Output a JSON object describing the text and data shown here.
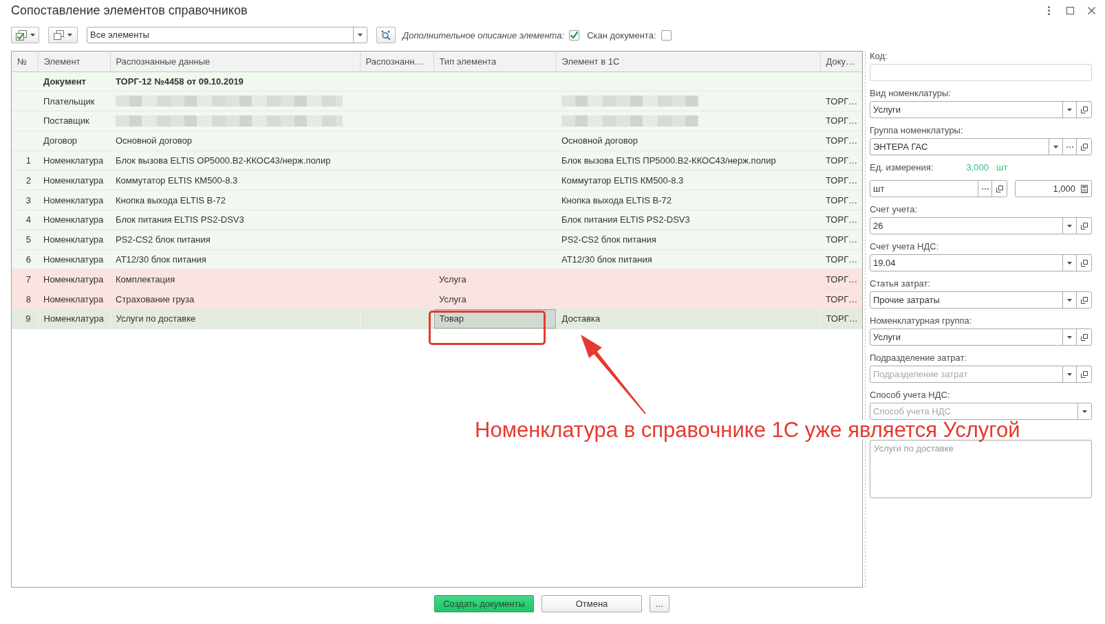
{
  "window": {
    "title": "Сопоставление элементов справочников"
  },
  "toolbar": {
    "filter": {
      "value": "Все элементы"
    },
    "options": [
      {
        "label": "Дополнительное описание элемента:",
        "italic": true,
        "checked": true
      },
      {
        "label": "Скан документа:",
        "italic": false,
        "checked": false
      }
    ]
  },
  "table": {
    "columns": [
      "№",
      "Элемент",
      "Распознанные данные",
      "Распознанн…",
      "Тип элемента",
      "Элемент в 1С",
      "Доку…"
    ],
    "rows": [
      {
        "kind": "document",
        "color": "#f1f8ef",
        "selected": false,
        "redacted": false,
        "type_cell_focused": false,
        "element": "Документ",
        "recognized_data": "ТОРГ-12 №4458 от 09.10.2019"
      },
      {
        "kind": "item",
        "color": "#f1f8ef",
        "selected": false,
        "redacted": true,
        "type_cell_focused": false,
        "element": "Плательщик",
        "document": "ТОРГ…"
      },
      {
        "kind": "item",
        "color": "#f1f8ef",
        "selected": false,
        "redacted": true,
        "type_cell_focused": false,
        "element": "Поставщик",
        "document": "ТОРГ…"
      },
      {
        "kind": "item",
        "color": "#f1f8ef",
        "selected": false,
        "redacted": false,
        "type_cell_focused": false,
        "element": "Договор",
        "recognized_data": "Основной договор",
        "element_1c": "Основной договор",
        "document": "ТОРГ…"
      },
      {
        "kind": "item",
        "color": "#f1f8ef",
        "selected": false,
        "redacted": false,
        "type_cell_focused": false,
        "no": "1",
        "element": "Номенклатура",
        "recognized_data": "Блок вызова ELTIS OP5000.B2-ККОС43/нерж.полир",
        "element_1c": "Блок вызова ELTIS ПР5000.B2-ККОС43/нерж.полир",
        "document": "ТОРГ…"
      },
      {
        "kind": "item",
        "color": "#f1f8ef",
        "selected": false,
        "redacted": false,
        "type_cell_focused": false,
        "no": "2",
        "element": "Номенклатура",
        "recognized_data": "Коммутатор ELTIS КМ500-8.3",
        "element_1c": "Коммутатор ELTIS КМ500-8.3",
        "document": "ТОРГ…"
      },
      {
        "kind": "item",
        "color": "#f1f8ef",
        "selected": false,
        "redacted": false,
        "type_cell_focused": false,
        "no": "3",
        "element": "Номенклатура",
        "recognized_data": "Кнопка выхода ELTIS B-72",
        "element_1c": "Кнопка выхода ELTIS B-72",
        "document": "ТОРГ…"
      },
      {
        "kind": "item",
        "color": "#f1f8ef",
        "selected": false,
        "redacted": false,
        "type_cell_focused": false,
        "no": "4",
        "element": "Номенклатура",
        "recognized_data": "Блок питания ELTIS PS2-DSV3",
        "element_1c": "Блок питания ELTIS PS2-DSV3",
        "document": "ТОРГ…"
      },
      {
        "kind": "item",
        "color": "#f1f8ef",
        "selected": false,
        "redacted": false,
        "type_cell_focused": false,
        "no": "5",
        "element": "Номенклатура",
        "recognized_data": "PS2-CS2 блок питания",
        "element_1c": "PS2-CS2 блок питания",
        "document": "ТОРГ…"
      },
      {
        "kind": "item",
        "color": "#f1f8ef",
        "selected": false,
        "redacted": false,
        "type_cell_focused": false,
        "no": "6",
        "element": "Номенклатура",
        "recognized_data": "АТ12/30 блок питания",
        "element_1c": "АТ12/30 блок питания",
        "document": "ТОРГ…"
      },
      {
        "kind": "item",
        "color": "#fbe3e2",
        "selected": false,
        "redacted": false,
        "type_cell_focused": false,
        "no": "7",
        "element": "Номенклатура",
        "recognized_data": "Комплектация",
        "element_type": "Услуга",
        "document": "ТОРГ…"
      },
      {
        "kind": "item",
        "color": "#fbe3e2",
        "selected": false,
        "redacted": false,
        "type_cell_focused": false,
        "no": "8",
        "element": "Номенклатура",
        "recognized_data": "Страхование груза",
        "element_type": "Услуга",
        "document": "ТОРГ…"
      },
      {
        "kind": "item",
        "color": "#f1f8ef",
        "selected": true,
        "redacted": false,
        "type_cell_focused": true,
        "no": "9",
        "element": "Номенклатура",
        "recognized_data": "Услуги по доставке",
        "element_type": "Товар",
        "element_1c": "Доставка",
        "document": "ТОРГ…"
      }
    ]
  },
  "details": {
    "fields": [
      {
        "kind": "text",
        "label": "Код:",
        "dropdown_button": false,
        "choice_button": false,
        "open_button": false
      },
      {
        "kind": "select",
        "label": "Вид номенклатуры:",
        "value": "Услуги",
        "dropdown_button": true,
        "choice_button": false,
        "open_button": true
      },
      {
        "kind": "select",
        "label": "Группа номенклатуры:",
        "value": "ЭНТЕРА ГАС",
        "dropdown_button": true,
        "choice_button": true,
        "open_button": true
      },
      {
        "kind": "unit",
        "label": "Ед. измерения:",
        "quantity": "3,000",
        "quantity_unit": "шт",
        "value": "шт",
        "dropdown_button": false,
        "choice_button": true,
        "open_button": true,
        "factor": "1,000"
      },
      {
        "kind": "select",
        "label": "Счет учета:",
        "value": "26",
        "dropdown_button": true,
        "choice_button": false,
        "open_button": true
      },
      {
        "kind": "select",
        "label": "Счет учета НДС:",
        "value": "19.04",
        "dropdown_button": true,
        "choice_button": false,
        "open_button": true
      },
      {
        "kind": "select",
        "label": "Статья затрат:",
        "value": "Прочие затраты",
        "dropdown_button": true,
        "choice_button": false,
        "open_button": true
      },
      {
        "kind": "select",
        "label": "Номенклатурная группа:",
        "value": "Услуги",
        "dropdown_button": true,
        "choice_button": false,
        "open_button": true
      },
      {
        "kind": "select",
        "label": "Подразделение затрат:",
        "placeholder": "Подразделение затрат",
        "dropdown_button": true,
        "choice_button": false,
        "open_button": true
      },
      {
        "kind": "select",
        "label": "Способ учета НДС:",
        "placeholder": "Способ учета НДС",
        "dropdown_button": true,
        "choice_button": false,
        "open_button": false
      },
      {
        "kind": "memo",
        "placeholder": "Услуги по доставке",
        "dropdown_button": false,
        "choice_button": false,
        "open_button": false
      }
    ]
  },
  "footer": {
    "buttons": [
      {
        "label": "Создать документы",
        "kind": "primary"
      },
      {
        "label": "Отмена",
        "kind": "default"
      },
      {
        "label": "...",
        "kind": "default"
      }
    ]
  },
  "annotation": {
    "text": "Номенклатура в справочнике 1С уже является Услугой"
  }
}
